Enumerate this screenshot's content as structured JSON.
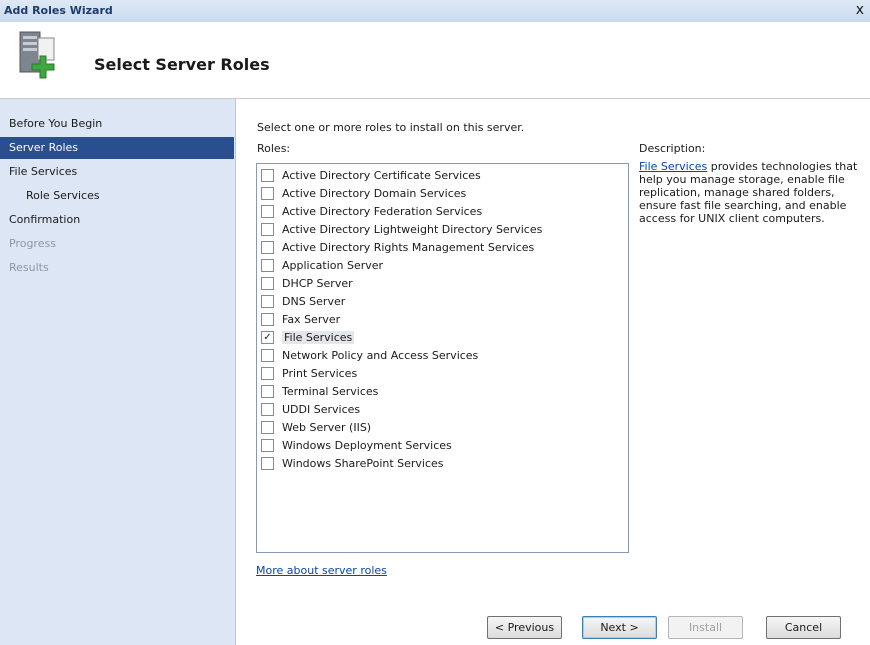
{
  "window": {
    "title": "Add Roles Wizard",
    "close_glyph": "x"
  },
  "header": {
    "title": "Select Server Roles",
    "icon": "server-roles-icon"
  },
  "sidebar": {
    "items": [
      {
        "label": "Before You Begin",
        "state": "normal"
      },
      {
        "label": "Server Roles",
        "state": "active"
      },
      {
        "label": "File Services",
        "state": "normal"
      },
      {
        "label": "Role Services",
        "state": "normal",
        "sub": true
      },
      {
        "label": "Confirmation",
        "state": "normal"
      },
      {
        "label": "Progress",
        "state": "disabled"
      },
      {
        "label": "Results",
        "state": "disabled"
      }
    ]
  },
  "main": {
    "instruction": "Select one or more roles to install on this server.",
    "roles_label": "Roles:",
    "roles": [
      {
        "label": "Active Directory Certificate Services",
        "checked": false
      },
      {
        "label": "Active Directory Domain Services",
        "checked": false
      },
      {
        "label": "Active Directory Federation Services",
        "checked": false
      },
      {
        "label": "Active Directory Lightweight Directory Services",
        "checked": false
      },
      {
        "label": "Active Directory Rights Management Services",
        "checked": false
      },
      {
        "label": "Application Server",
        "checked": false
      },
      {
        "label": "DHCP Server",
        "checked": false
      },
      {
        "label": "DNS Server",
        "checked": false
      },
      {
        "label": "Fax Server",
        "checked": false
      },
      {
        "label": "File Services",
        "checked": true
      },
      {
        "label": "Network Policy and Access Services",
        "checked": false
      },
      {
        "label": "Print Services",
        "checked": false
      },
      {
        "label": "Terminal Services",
        "checked": false
      },
      {
        "label": "UDDI Services",
        "checked": false
      },
      {
        "label": "Web Server (IIS)",
        "checked": false
      },
      {
        "label": "Windows Deployment Services",
        "checked": false
      },
      {
        "label": "Windows SharePoint Services",
        "checked": false
      }
    ],
    "description": {
      "title": "Description:",
      "link": "File Services",
      "text": " provides technologies that help you manage storage, enable file replication, manage shared folders, ensure fast file searching, and enable access for UNIX client computers."
    },
    "more_link": "More about server roles"
  },
  "buttons": {
    "previous": "< Previous",
    "next": "Next >",
    "install": "Install",
    "cancel": "Cancel"
  },
  "colors": {
    "sidebar_bg": "#dce6f4",
    "active_nav": "#2a4f8f",
    "link": "#0645ad"
  }
}
